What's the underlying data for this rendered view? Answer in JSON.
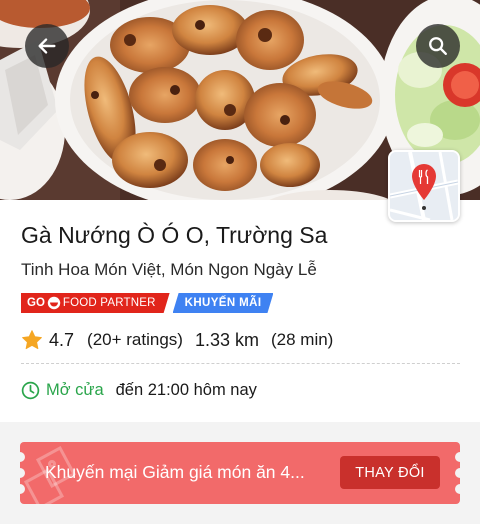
{
  "header": {
    "back_icon": "arrow-left-icon",
    "search_icon": "search-icon",
    "map_icon": "map-pin-restaurant-icon"
  },
  "restaurant": {
    "name": "Gà Nướng Ò Ó O, Trường Sa",
    "cuisine": "Tinh Hoa Món Việt, Món Ngon Ngày Lễ"
  },
  "badges": {
    "gofood_prefix": "GO",
    "gofood_suffix": "FOOD PARTNER",
    "promo": "KHUYẾN MÃI"
  },
  "stats": {
    "rating": "4.7",
    "ratings_count": "(20+ ratings)",
    "distance": "1.33 km",
    "duration": "(28 min)"
  },
  "hours": {
    "status": "Mở cửa",
    "until": "đến 21:00 hôm nay"
  },
  "promotion": {
    "text": "Khuyến mại Giảm giá món ăn 4...",
    "button": "THAY ĐỔI"
  },
  "colors": {
    "open_green": "#2aa54b",
    "gofood_red": "#e1251b",
    "promo_blue": "#3f82f2",
    "banner_red": "#f26a6a",
    "banner_button": "#c9302c",
    "star": "#f5a623"
  }
}
